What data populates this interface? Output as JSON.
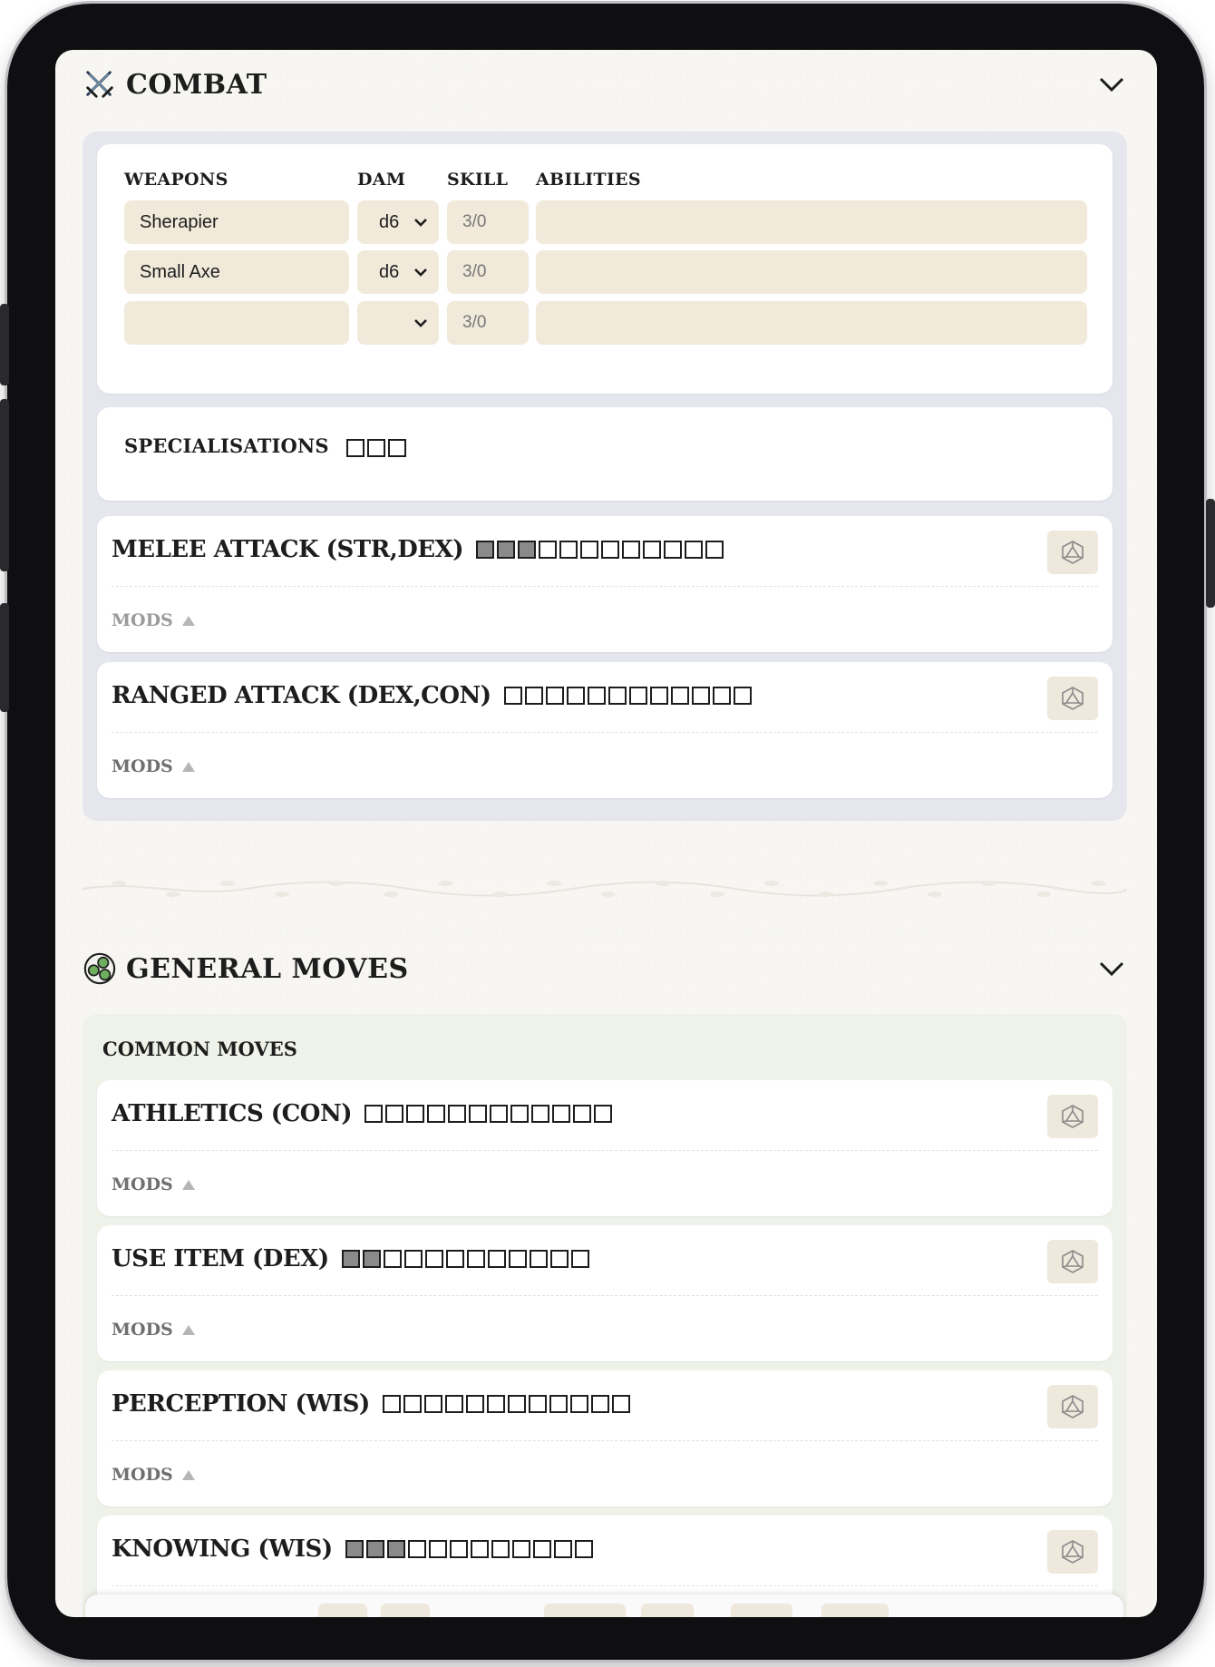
{
  "combat": {
    "title": "Combat",
    "icon": "crossed-swords-icon",
    "weapons_table": {
      "headers": {
        "weapons": "Weapons",
        "dam": "Dam",
        "skill": "Skill",
        "abilities": "Abilities"
      },
      "rows": [
        {
          "name": "Sherapier",
          "dam": "d6",
          "skill": "3/0",
          "abilities": ""
        },
        {
          "name": "Small Axe",
          "dam": "d6",
          "skill": "3/0",
          "abilities": ""
        },
        {
          "name": "",
          "dam": "",
          "skill": "3/0",
          "abilities": ""
        }
      ]
    },
    "specialisations": {
      "label": "Specialisations",
      "boxes": 3,
      "filled": 0
    },
    "moves": [
      {
        "title": "Melee Attack (STR,DEX)",
        "boxes": 12,
        "filled": 3,
        "mods_label": "Mods"
      },
      {
        "title": "Ranged Attack (DEX,CON)",
        "boxes": 12,
        "filled": 0,
        "mods_label": "Mods"
      }
    ]
  },
  "general_moves": {
    "title": "General Moves",
    "icon": "three-circles-icon",
    "subsection": "Common Moves",
    "moves": [
      {
        "title": "Athletics (CON)",
        "boxes": 12,
        "filled": 0,
        "mods_label": "Mods"
      },
      {
        "title": "Use Item (DEX)",
        "boxes": 12,
        "filled": 2,
        "mods_label": "Mods"
      },
      {
        "title": "Perception (WIS)",
        "boxes": 12,
        "filled": 0,
        "mods_label": "Mods"
      },
      {
        "title": "Knowing (WIS)",
        "boxes": 12,
        "filled": 3,
        "mods_label": "Mods"
      }
    ]
  },
  "colors": {
    "combat_panel": "#e5e6ee",
    "moves_panel": "#eef2e8",
    "field_bg": "#f1e9da",
    "filled_box": "#8a8a8a"
  }
}
